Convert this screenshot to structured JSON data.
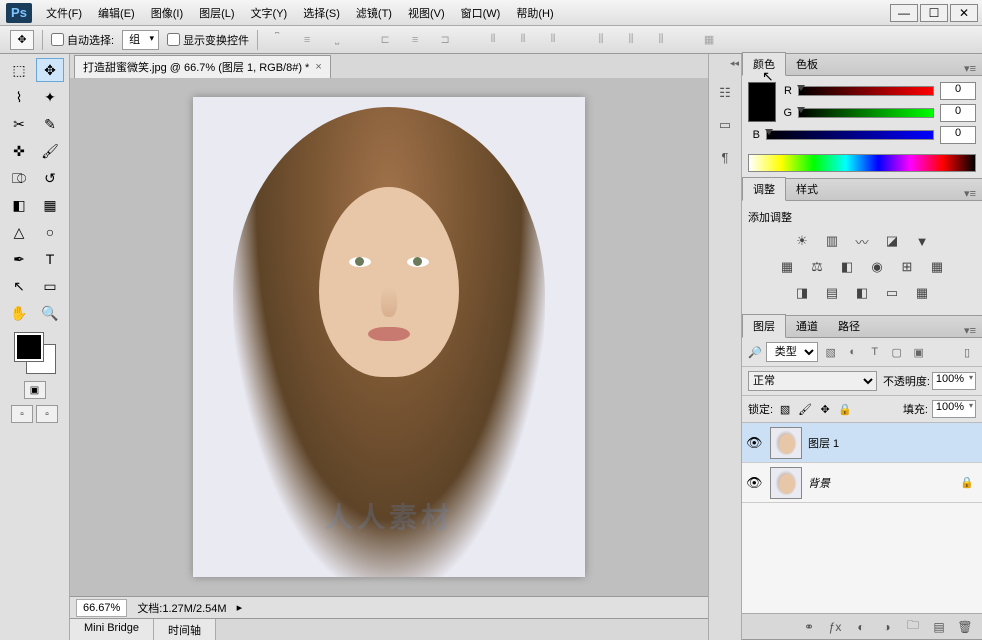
{
  "menubar": {
    "items": [
      "文件(F)",
      "编辑(E)",
      "图像(I)",
      "图层(L)",
      "文字(Y)",
      "选择(S)",
      "滤镜(T)",
      "视图(V)",
      "窗口(W)",
      "帮助(H)"
    ]
  },
  "options": {
    "auto_select_label": "自动选择:",
    "auto_select_value": "组",
    "show_transform_label": "显示变换控件"
  },
  "doc_tab": {
    "title": "打造甜蜜微笑.jpg @ 66.7% (图层 1, RGB/8#) *"
  },
  "status": {
    "zoom": "66.67%",
    "doc_info": "文档:1.27M/2.54M"
  },
  "bottom_tabs": [
    "Mini Bridge",
    "时间轴"
  ],
  "color_panel": {
    "tabs": [
      "颜色",
      "色板"
    ],
    "channels": [
      {
        "label": "R",
        "value": "0"
      },
      {
        "label": "G",
        "value": "0"
      },
      {
        "label": "B",
        "value": "0"
      }
    ]
  },
  "adjust_panel": {
    "tabs": [
      "调整",
      "样式"
    ],
    "title": "添加调整"
  },
  "layers_panel": {
    "tabs": [
      "图层",
      "通道",
      "路径"
    ],
    "filter_kind": "类型",
    "blend_mode": "正常",
    "opacity_label": "不透明度:",
    "opacity_value": "100%",
    "lock_label": "锁定:",
    "fill_label": "填充:",
    "fill_value": "100%",
    "layers": [
      {
        "name": "图层 1",
        "selected": true,
        "locked": false,
        "italic": false
      },
      {
        "name": "背景",
        "selected": false,
        "locked": true,
        "italic": true
      }
    ]
  },
  "watermark": "人人素材"
}
